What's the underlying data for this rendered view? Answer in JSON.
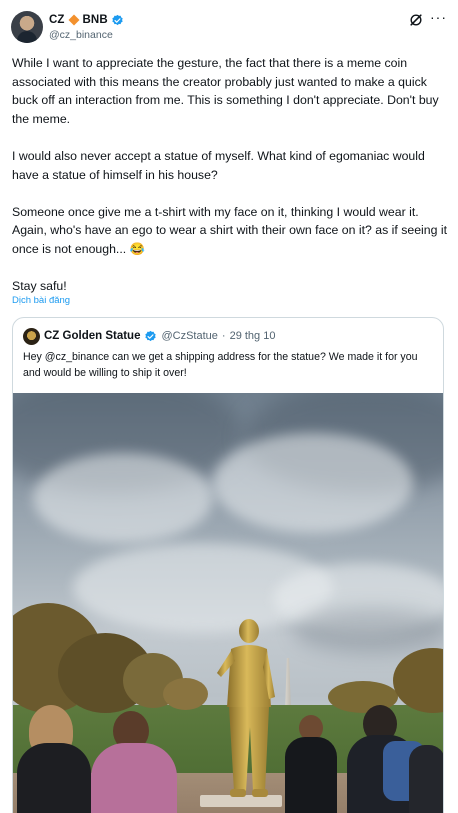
{
  "author": {
    "display_name": "CZ",
    "badge_text": "BNB",
    "handle": "@cz_binance"
  },
  "tweet": {
    "paragraphs": [
      "While I want to appreciate the gesture, the fact that there is a meme coin associated with this means the creator probably just wanted to make a quick buck off an interaction from me. This is something I don't appreciate. Don't buy the meme.",
      "I would also never accept a statue of myself. What kind of egomaniac would have a statue of himself in his house?",
      "Someone once give me a t-shirt with my face on it, thinking I would wear it. Again, who's have an ego to wear a shirt with their own face on it? as if seeing it once is not enough... 😂",
      "Stay safu!"
    ],
    "translate_label": "Dịch bài đăng"
  },
  "quoted": {
    "display_name": "CZ Golden Statue",
    "handle": "@CzStatue",
    "separator": "·",
    "date": "29 thg 10",
    "text": "Hey @cz_binance can we get a shipping address for the statue? We made it for you and would be willing to ship it over!"
  },
  "icons": {
    "verified": "verified-badge-icon",
    "diamond": "bnb-diamond-icon",
    "grok": "grok-icon",
    "more": "more-options-icon"
  },
  "colors": {
    "link": "#1d9bf0",
    "secondary_text": "#536471",
    "border": "#cfd9de",
    "bnb_orange": "#f3912e"
  }
}
